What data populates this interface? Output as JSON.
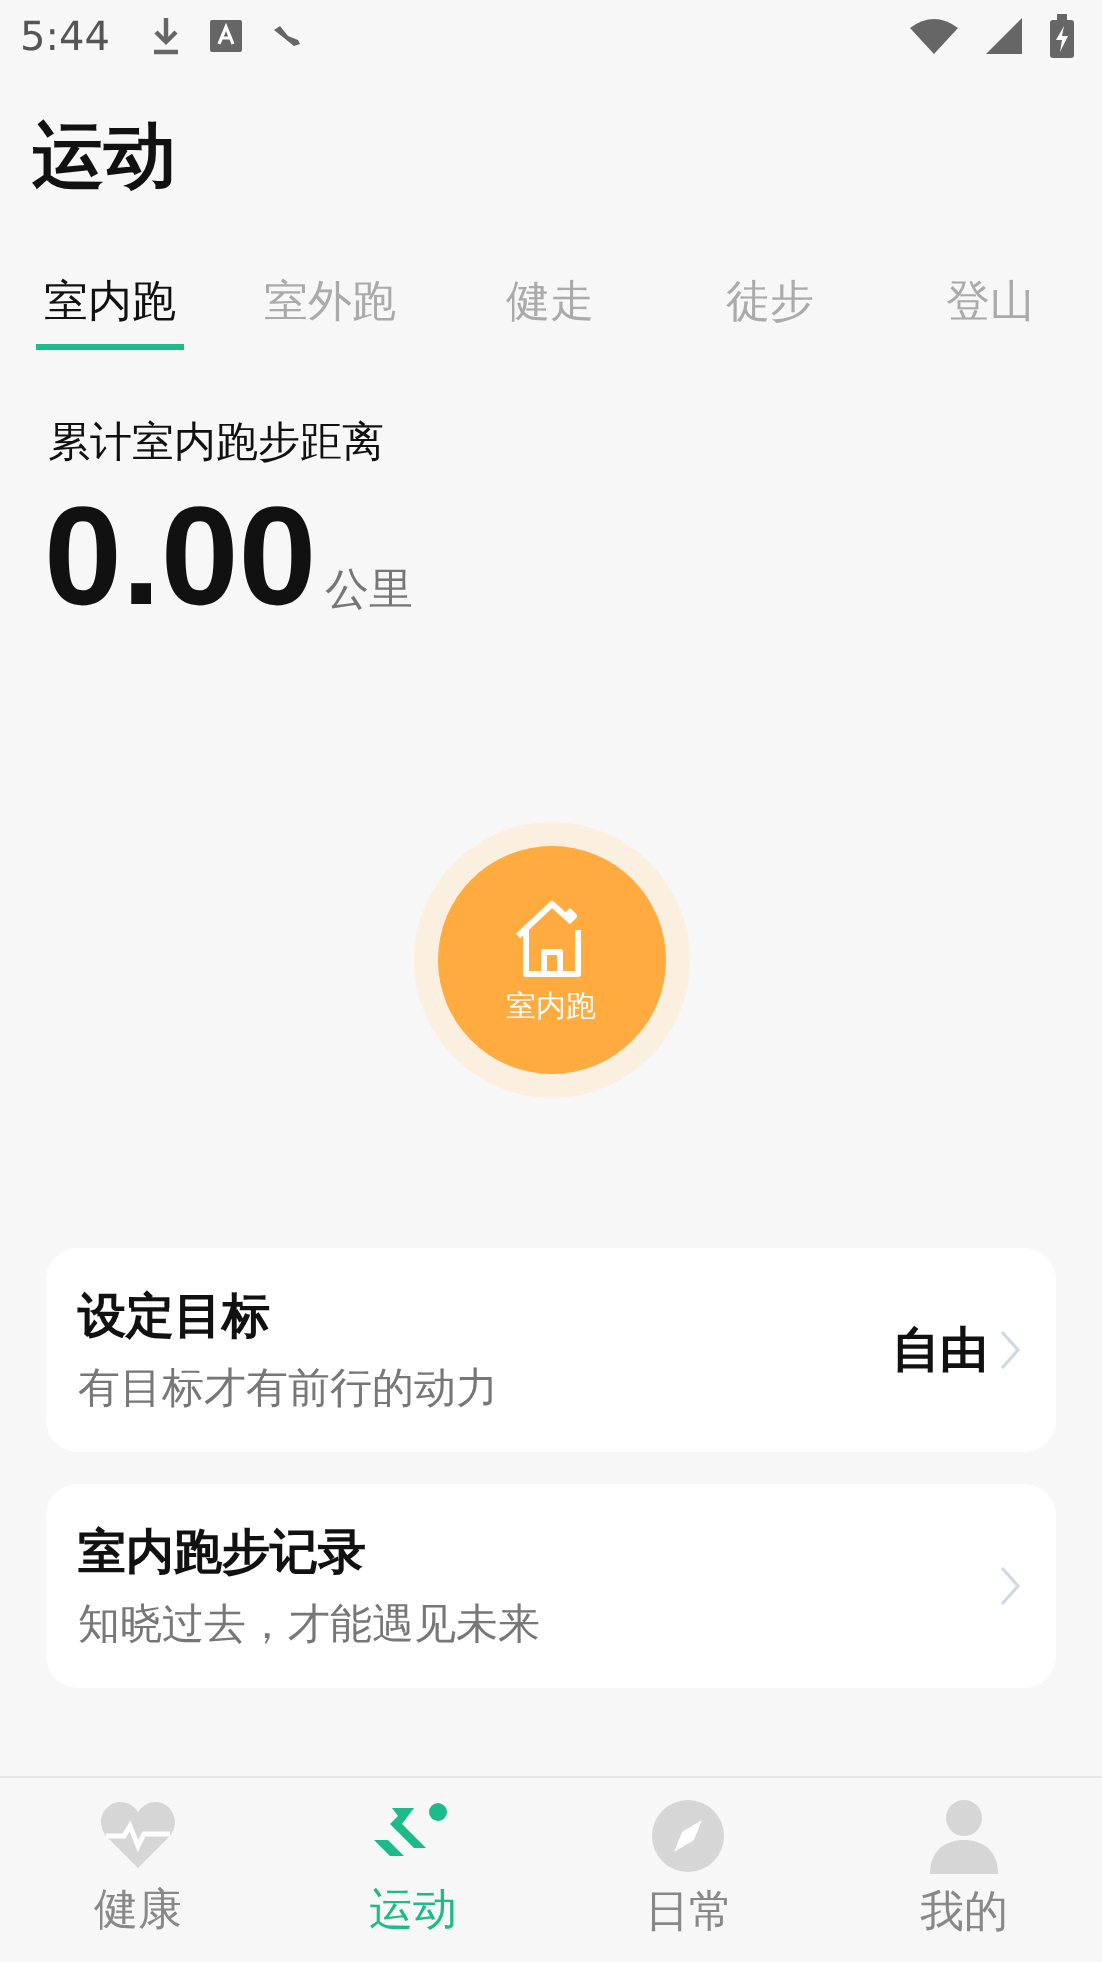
{
  "status_bar": {
    "time": "5:44"
  },
  "title": "运动",
  "tabs": [
    {
      "label": "室内跑",
      "selected": true
    },
    {
      "label": "室外跑",
      "selected": false
    },
    {
      "label": "健走",
      "selected": false
    },
    {
      "label": "徒步",
      "selected": false
    },
    {
      "label": "登山",
      "selected": false
    }
  ],
  "distance": {
    "label": "累计室内跑步距离",
    "value": "0.00",
    "unit": "公里"
  },
  "start_button": {
    "label": "室内跑"
  },
  "cards": [
    {
      "title": "设定目标",
      "subtitle": "有目标才有前行的动力",
      "value": "自由"
    },
    {
      "title": "室内跑步记录",
      "subtitle": "知晓过去，才能遇见未来"
    }
  ],
  "bottom_nav": [
    {
      "label": "健康",
      "kind": "heart",
      "selected": false
    },
    {
      "label": "运动",
      "kind": "run",
      "selected": true
    },
    {
      "label": "日常",
      "kind": "compass",
      "selected": false
    },
    {
      "label": "我的",
      "kind": "person",
      "selected": false
    }
  ]
}
